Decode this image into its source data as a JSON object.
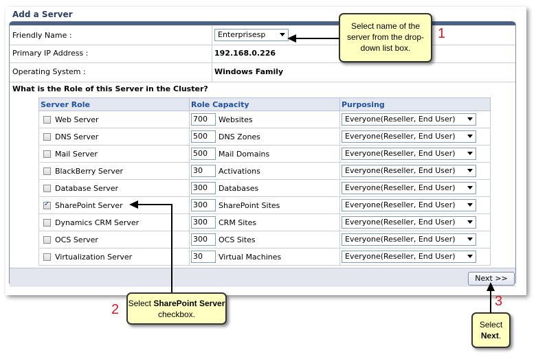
{
  "panel_title": "Add a Server",
  "fields": {
    "friendly_name": {
      "label": "Friendly Name :",
      "value": "Enterprisesp"
    },
    "primary_ip": {
      "label": "Primary IP Address :",
      "value": "192.168.0.226"
    },
    "os": {
      "label": "Operating System :",
      "value": "Windows Family"
    }
  },
  "role_question": "What is the Role of this Server in the Cluster?",
  "table": {
    "headers": [
      "Server Role",
      "Role Capacity",
      "Purposing"
    ],
    "rows": [
      {
        "role": "Web Server",
        "checked": false,
        "capacity": "700",
        "unit": "Websites",
        "purposing": "Everyone(Reseller, End User)"
      },
      {
        "role": "DNS Server",
        "checked": false,
        "capacity": "500",
        "unit": "DNS Zones",
        "purposing": "Everyone(Reseller, End User)"
      },
      {
        "role": "Mail Server",
        "checked": false,
        "capacity": "500",
        "unit": "Mail Domains",
        "purposing": "Everyone(Reseller, End User)"
      },
      {
        "role": "BlackBerry Server",
        "checked": false,
        "capacity": "30",
        "unit": "Activations",
        "purposing": "Everyone(Reseller, End User)"
      },
      {
        "role": "Database Server",
        "checked": false,
        "capacity": "300",
        "unit": "Databases",
        "purposing": "Everyone(Reseller, End User)"
      },
      {
        "role": "SharePoint Server",
        "checked": true,
        "capacity": "300",
        "unit": "SharePoint Sites",
        "purposing": "Everyone(Reseller, End User)"
      },
      {
        "role": "Dynamics CRM Server",
        "checked": false,
        "capacity": "300",
        "unit": "CRM Sites",
        "purposing": "Everyone(Reseller, End User)"
      },
      {
        "role": "OCS Server",
        "checked": false,
        "capacity": "300",
        "unit": "OCS Sites",
        "purposing": "Everyone(Reseller, End User)"
      },
      {
        "role": "Virtualization Server",
        "checked": false,
        "capacity": "30",
        "unit": "Virtual Machines",
        "purposing": "Everyone(Reseller, End User)"
      }
    ]
  },
  "next_button": "Next >>",
  "callouts": {
    "c1": {
      "number": "1",
      "text": "Select name of the server from the drop-down list box."
    },
    "c2": {
      "number": "2",
      "text_pre": "Select ",
      "text_bold": "SharePoint Server",
      "text_post": " checkbox."
    },
    "c3": {
      "number": "3",
      "text_pre": "Select ",
      "text_bold": "Next",
      "text_post": "."
    }
  },
  "colors": {
    "header_bar": "#4a6188",
    "header_text": "#2050a0",
    "callout_bg": "#ffffc0",
    "step_number": "#e0171f"
  }
}
